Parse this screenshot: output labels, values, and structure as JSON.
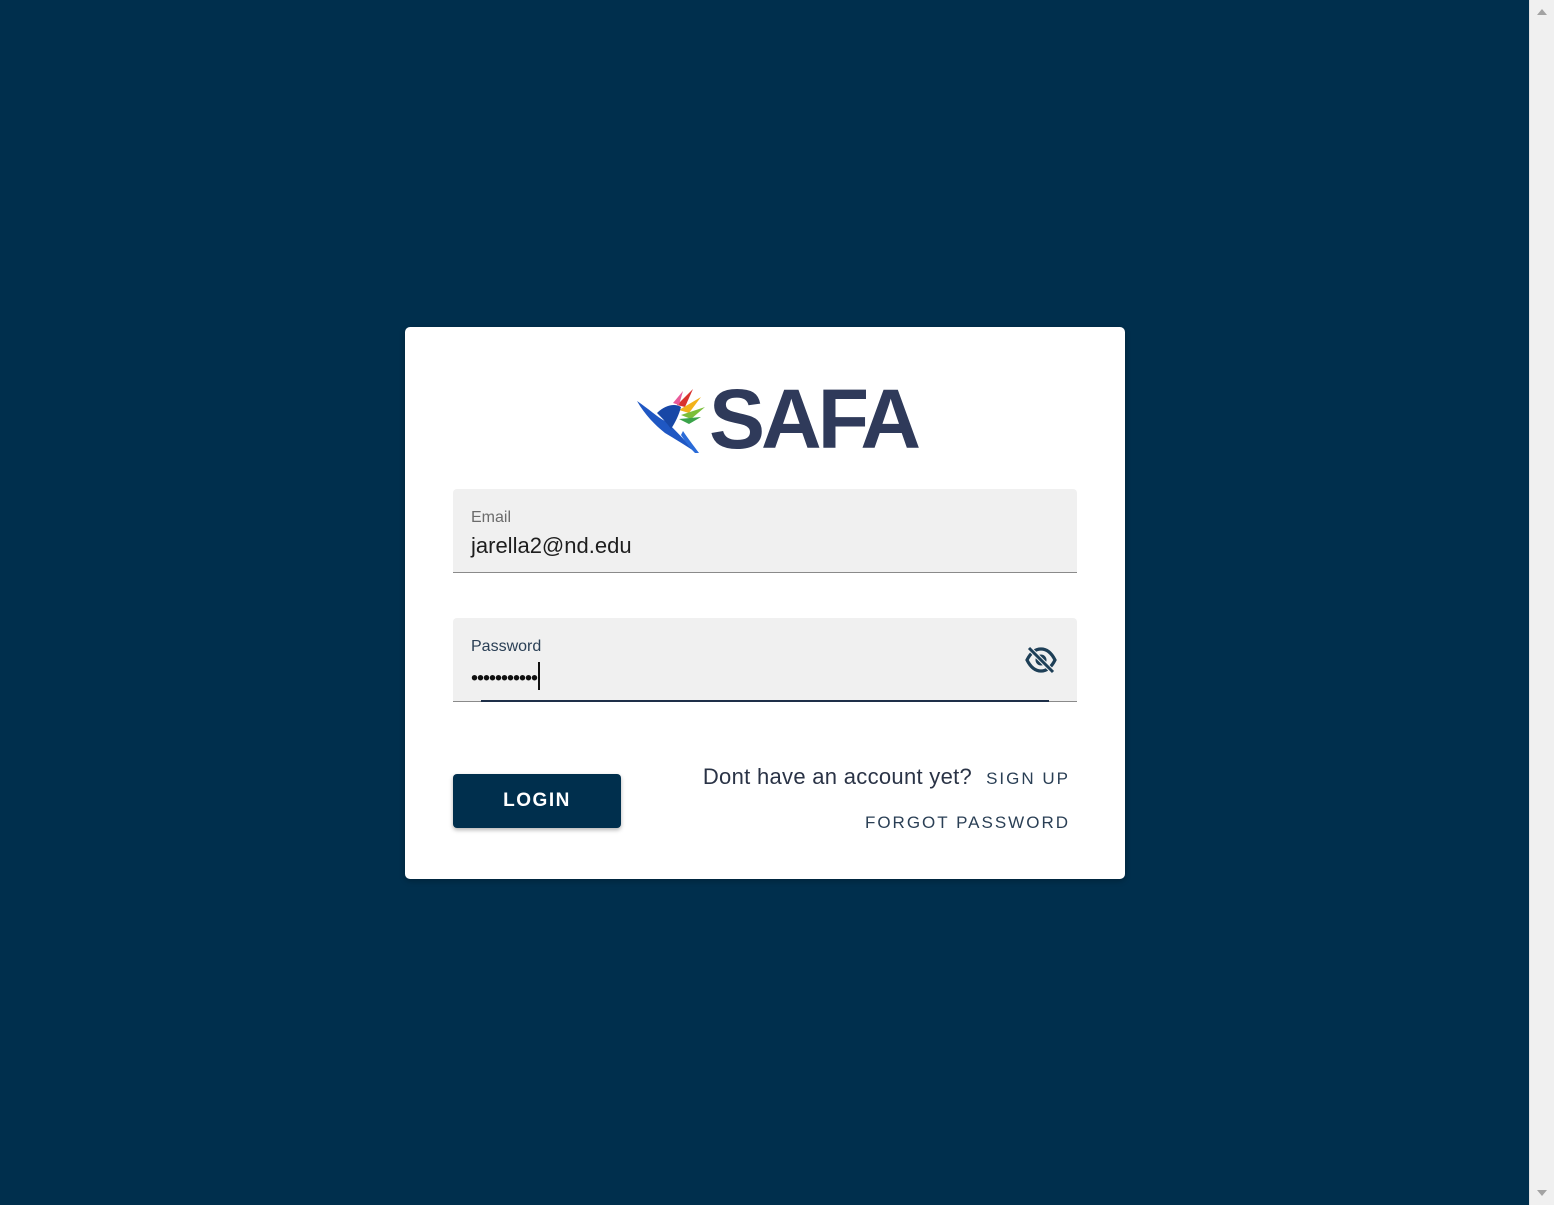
{
  "app": {
    "brand_name": "SAFA",
    "logo_icon": "hummingbird-logo-icon"
  },
  "form": {
    "email": {
      "label": "Email",
      "value": "jarella2@nd.edu"
    },
    "password": {
      "label": "Password",
      "masked_value": "•••••••••••",
      "toggle_icon": "eye-off-icon"
    },
    "login_button": "LOGIN",
    "signup_prompt": "Dont have an account yet?",
    "signup_link": "SIGN UP",
    "forgot_password_link": "FORGOT PASSWORD"
  },
  "colors": {
    "background": "#002f4d",
    "card": "#ffffff",
    "field_bg": "#f0f0f0",
    "brand_text": "#2f3a5a",
    "button": "#002f4d"
  }
}
